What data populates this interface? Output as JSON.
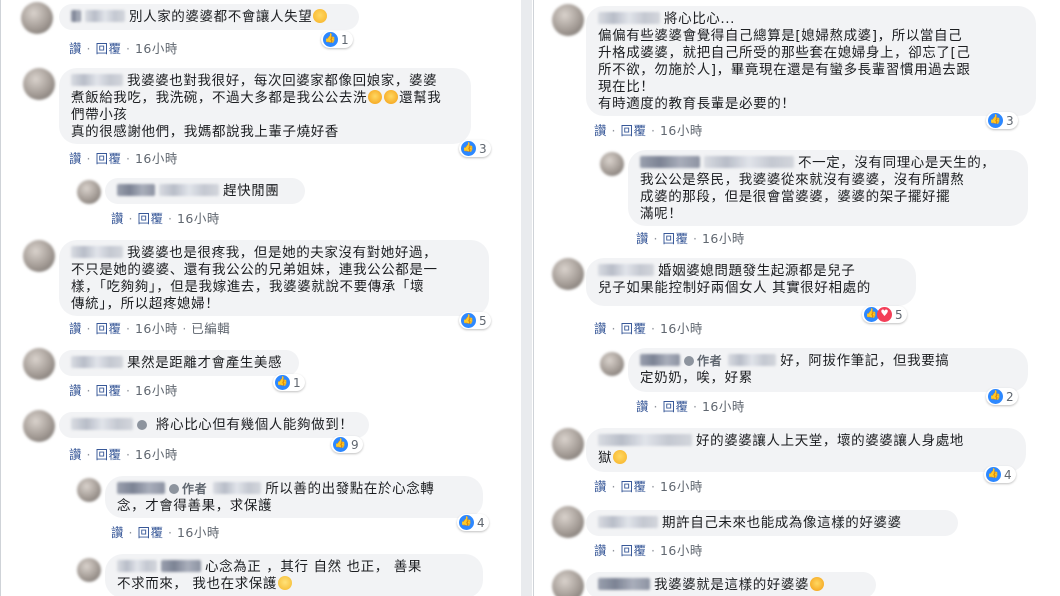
{
  "actions": {
    "like": "讚",
    "reply": "回覆",
    "sep": "·",
    "time": "16小時",
    "edited": "已編輯"
  },
  "author_label": "作者",
  "icons": {
    "like": "thumbs-up-icon",
    "love": "heart-icon",
    "verified": "verified-icon"
  },
  "colors": {
    "link": "#385898",
    "bubble": "#f2f3f5",
    "like": "#2d88ff",
    "love": "#f33e58"
  },
  "left": [
    {
      "text": "別人家的婆婆都不會讓人失望",
      "emoji_after": "sad",
      "reactions": "1"
    },
    {
      "text": "我婆婆也對我很好，每次回婆家都像回娘家，婆婆\n煮飯給我吃，我洗碗，不過大多都是我公公去洗",
      "emoji_mid": "laugh",
      "text2": "還幫我\n們帶小孩\n真的很感謝他們，我媽都說我上輩子燒好香",
      "reactions": "3"
    },
    {
      "text": "趕快閒團"
    },
    {
      "text": "我婆婆也是很疼我，但是她的夫家沒有對她好過，\n不只是她的婆婆、還有我公公的兄弟姐妹，連我公公都是一\n樣，「吃夠夠」，但是我嫁進去，我婆婆就說不要傳承「壞\n傳統」，所以超疼媳婦！",
      "reactions": "5"
    },
    {
      "text": "果然是距離才會產生美感",
      "reactions": "1"
    },
    {
      "text": "將心比心但有幾個人能夠做到！",
      "reactions": "9"
    },
    {
      "text": "所以善的出發點在於心念轉\n念，才會得善果，求保護",
      "reactions": "4"
    },
    {
      "text": "心念為正 ，其行 自然 也正， 善果\n不求而來， 我也在求保護"
    }
  ],
  "right": [
    {
      "text": "將心比心...\n偏偏有些婆婆會覺得自己總算是[媳婦熬成婆]，所以當自己\n升格成婆婆，就把自己所受的那些套在媳婦身上，卻忘了[己\n所不欲，勿施於人]，畢竟現在還是有蠻多長輩習慣用過去跟\n現在比！\n有時適度的教育長輩是必要的！",
      "reactions": "3"
    },
    {
      "text": "不一定，沒有同理心是天生的，\n我公公是祭民，我婆婆從來就沒有婆婆，沒有所謂熬\n成婆的那段，但是很會當婆婆，婆婆的架子擺好擺\n滿呢！"
    },
    {
      "text": "婚姻婆媳問題發生起源都是兒子\n兒子如果能控制好兩個女人 其實很好相處的",
      "reactions": "5"
    },
    {
      "text": "好，阿拔作筆記，但我要搞\n定奶奶，唉，好累",
      "reactions": "2"
    },
    {
      "text": "好的婆婆讓人上天堂，壞的婆婆讓人身處地\n獄",
      "reactions": "4"
    },
    {
      "text": "期許自己未來也能成為像這樣的好婆婆"
    },
    {
      "text": "我婆婆就是這樣的好婆婆"
    }
  ]
}
